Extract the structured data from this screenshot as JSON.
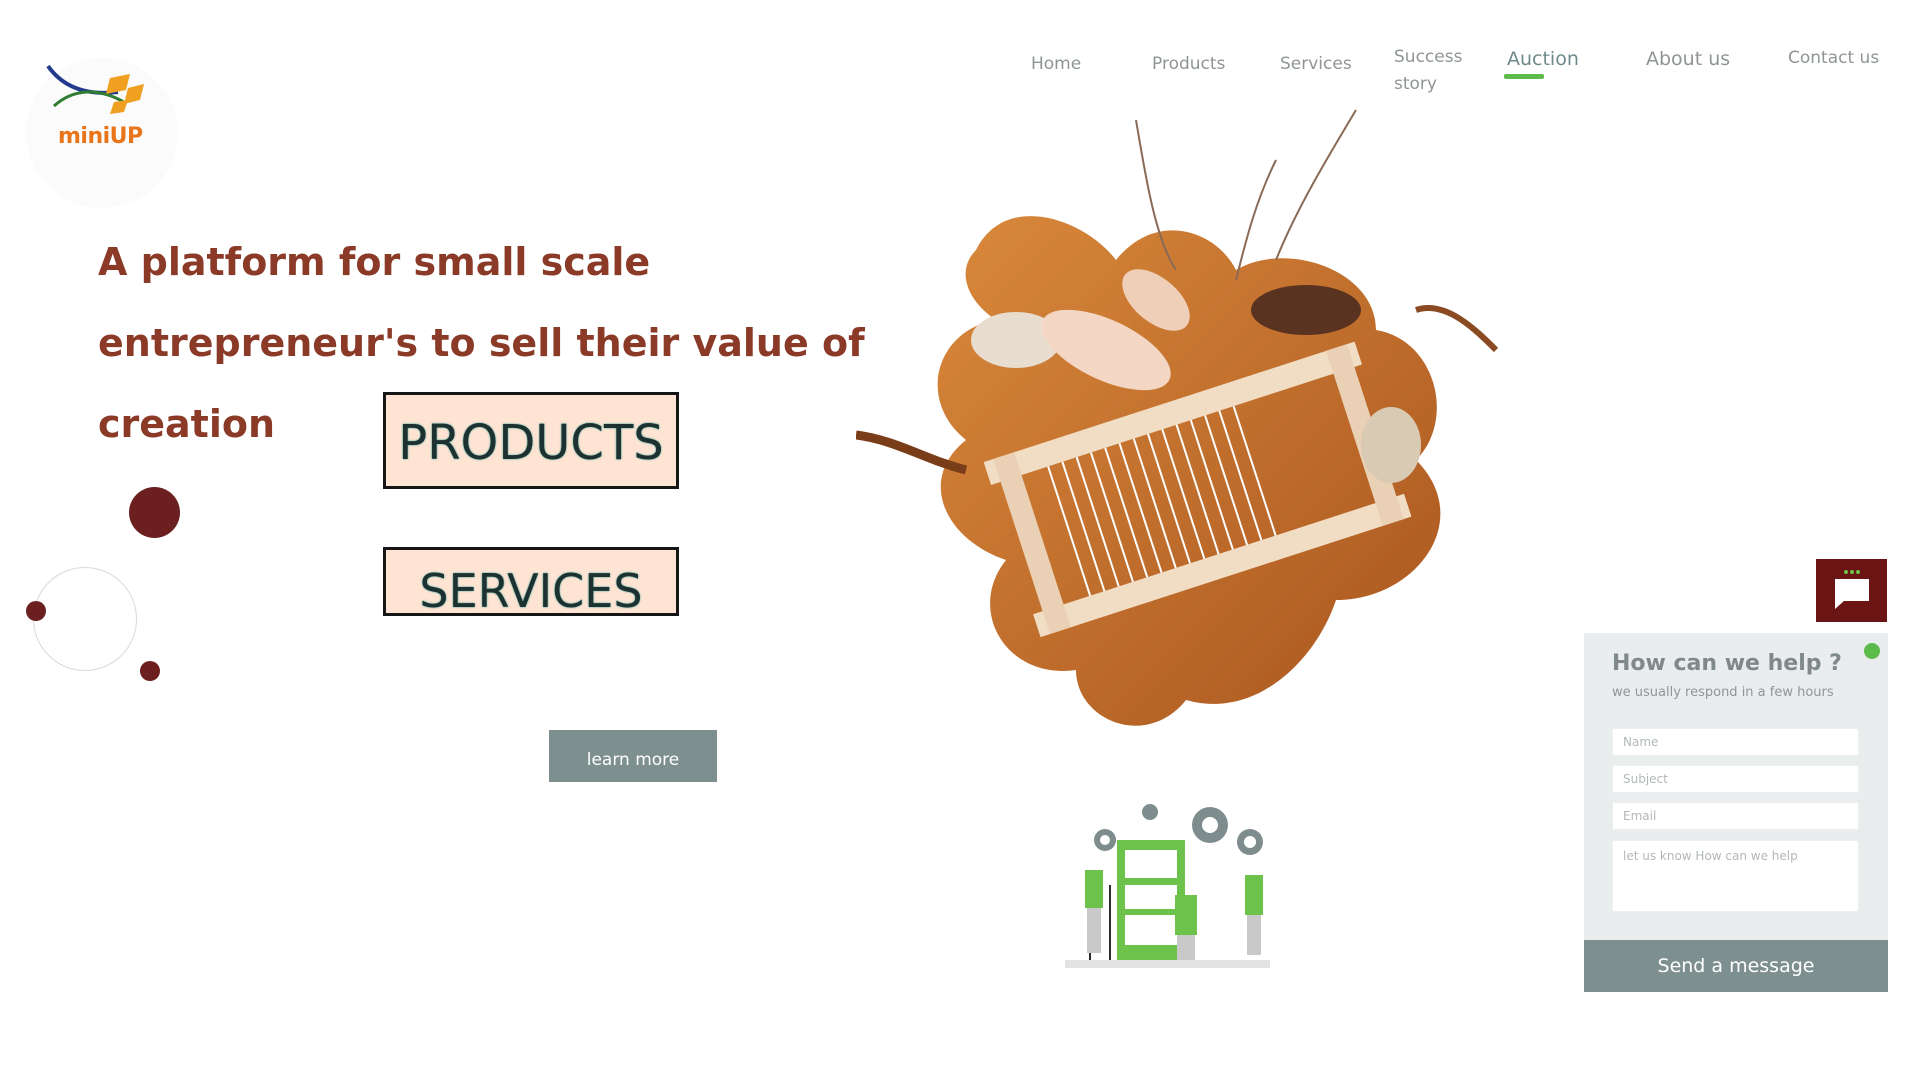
{
  "logo": {
    "text": "miniUP"
  },
  "nav": {
    "items": [
      {
        "label": "Home"
      },
      {
        "label": "Products"
      },
      {
        "label": "Services"
      },
      {
        "label": "Success story"
      },
      {
        "label": "Auction"
      },
      {
        "label": "About us"
      },
      {
        "label": "Contact us"
      }
    ],
    "active": "Auction"
  },
  "hero": {
    "title": "A platform for small scale entrepreneur's to sell their value of creation",
    "products_label": "PRODUCTS",
    "services_label": "SERVICES",
    "learn_more_label": "learn more"
  },
  "chat": {
    "title": "How can we help ?",
    "subtitle": "we usually respond in a few hours",
    "name_placeholder": "Name",
    "subject_placeholder": "Subject",
    "email_placeholder": "Email",
    "message_placeholder": "let us know How can we help",
    "send_label": "Send a message"
  },
  "colors": {
    "accent_brown": "#8b3a27",
    "button_fill": "#ffe4d3",
    "gray_button": "#7e8f8f",
    "chat_icon_bg": "#6a1414",
    "green": "#5dbb4b"
  }
}
